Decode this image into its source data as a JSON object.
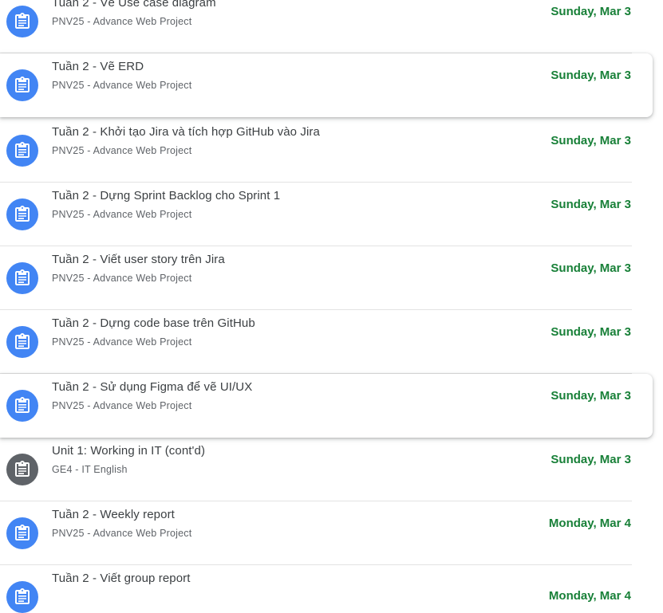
{
  "colors": {
    "assignment_icon_bg": "#4285f4",
    "material_icon_bg": "#5f6368",
    "due_date_text": "#188038",
    "title_text": "#3c4043",
    "subtitle_text": "#5f6368"
  },
  "items": [
    {
      "title": "Tuần 2 - Vẽ Use case diagram",
      "course": "PNV25 - Advance Web Project",
      "due": "Sunday, Mar 3",
      "icon": "assignment-icon"
    },
    {
      "title": "Tuần 2 - Vẽ ERD",
      "course": "PNV25 - Advance Web Project",
      "due": "Sunday, Mar 3",
      "icon": "assignment-icon"
    },
    {
      "title": "Tuần 2 - Khởi tạo Jira và tích hợp GitHub vào Jira",
      "course": "PNV25 - Advance Web Project",
      "due": "Sunday, Mar 3",
      "icon": "assignment-icon"
    },
    {
      "title": "Tuần 2 - Dựng Sprint Backlog cho Sprint 1",
      "course": "PNV25 - Advance Web Project",
      "due": "Sunday, Mar 3",
      "icon": "assignment-icon"
    },
    {
      "title": "Tuần 2 - Viết user story trên Jira",
      "course": "PNV25 - Advance Web Project",
      "due": "Sunday, Mar 3",
      "icon": "assignment-icon"
    },
    {
      "title": "Tuần 2 - Dựng code base trên GitHub",
      "course": "PNV25 - Advance Web Project",
      "due": "Sunday, Mar 3",
      "icon": "assignment-icon"
    },
    {
      "title": "Tuần 2 - Sử dụng Figma để vẽ UI/UX",
      "course": "PNV25 - Advance Web Project",
      "due": "Sunday, Mar 3",
      "icon": "assignment-icon"
    },
    {
      "title": "Unit 1: Working in IT (cont'd)",
      "course": "GE4 - IT English",
      "due": "Sunday, Mar 3",
      "icon": "assignment-icon"
    },
    {
      "title": "Tuần 2 - Weekly report",
      "course": "PNV25 - Advance Web Project",
      "due": "Monday, Mar 4",
      "icon": "assignment-icon"
    },
    {
      "title": "Tuần 2 - Viết group report",
      "course": "",
      "due": "Monday, Mar 4",
      "icon": "assignment-icon"
    }
  ]
}
